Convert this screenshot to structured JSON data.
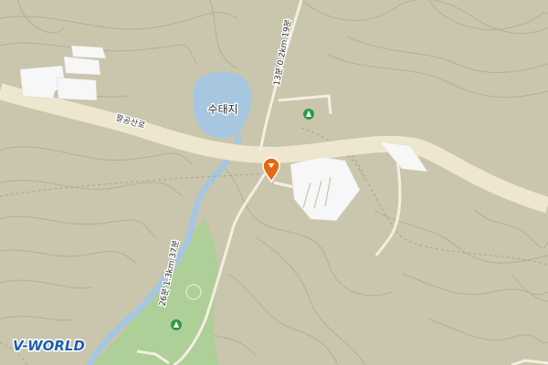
{
  "map": {
    "labels": {
      "pond": "수태지",
      "road": "팔공산로",
      "trail_upper": "13분 0.2km 19분",
      "trail_lower": "26분 1.3km 37분"
    },
    "markers": [
      {
        "name": "location-pin",
        "icon": "map-pin-icon",
        "color": "#e46a12"
      },
      {
        "name": "poi-upper",
        "icon": "tent-icon",
        "color": "#2e9a48"
      },
      {
        "name": "poi-lower",
        "icon": "tent-icon",
        "color": "#2e9a48"
      }
    ],
    "logo": "V-WORLD",
    "colors": {
      "terrain": "#c9c6ad",
      "contour": "#b4b098",
      "road": "#eee6cf",
      "water": "#a7c6e0",
      "forest": "#aecf97",
      "building": "#f7f7f7"
    }
  }
}
